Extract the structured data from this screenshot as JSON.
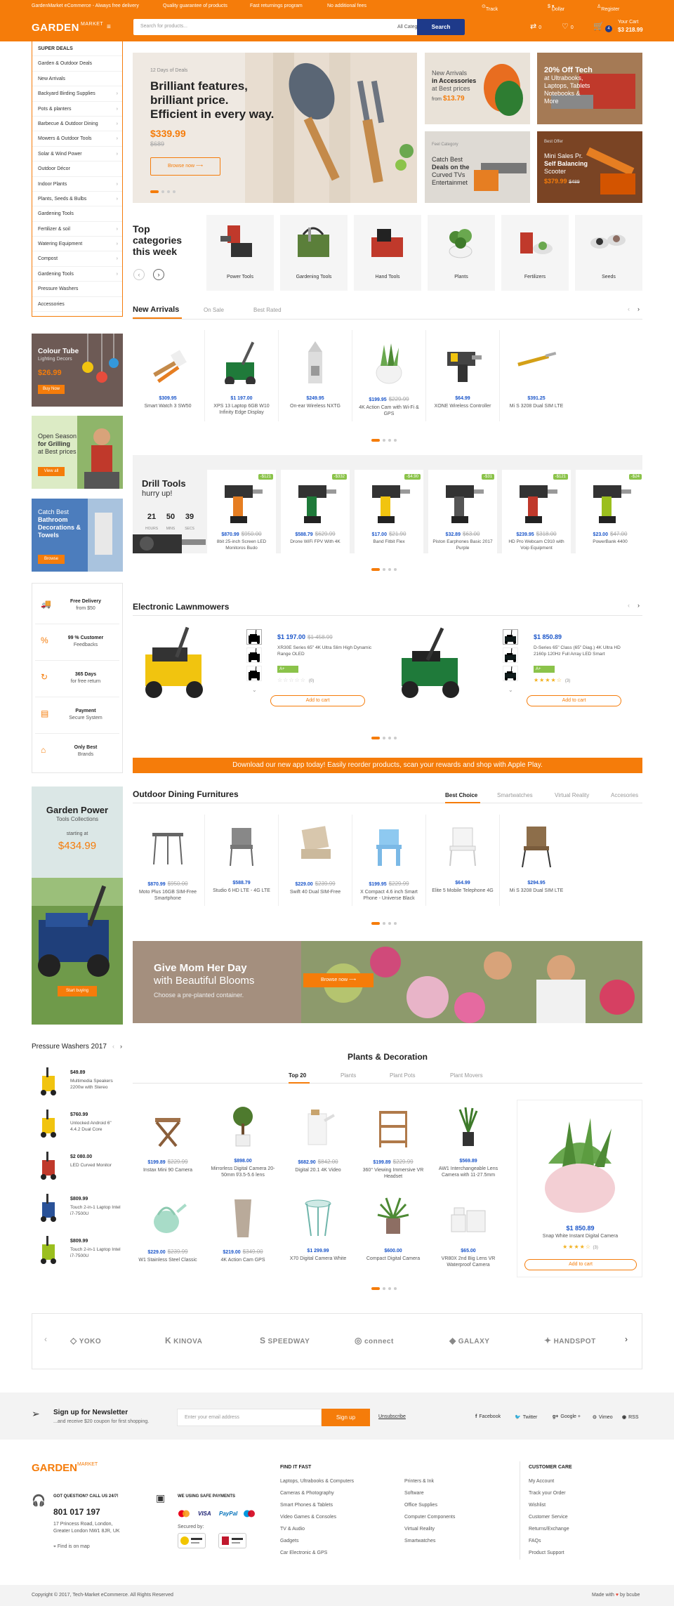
{
  "topbar": {
    "left": "GardenMarket eCommerce - Always free delivery",
    "items": [
      "Quality guarantee of products",
      "Fast returnings program",
      "No additional fees"
    ],
    "track": "Track Your Order",
    "currency": "Dollar (US)",
    "account": "Register or Sign in"
  },
  "header": {
    "logo": "GARDEN",
    "logo_sub": "MARKET",
    "search_placeholder": "Search for products...",
    "category": "All Categories",
    "search_btn": "Search",
    "compare_count": "0",
    "wishlist_count": "0",
    "cart_count": "4",
    "cart_label": "Your Cart",
    "cart_total": "$3 218.99"
  },
  "sidebar": {
    "items": [
      {
        "label": "SUPER DEALS",
        "arrow": false
      },
      {
        "label": "Garden & Outdoor Deals",
        "arrow": false
      },
      {
        "label": "New Arrivals",
        "arrow": false
      },
      {
        "label": "Backyard Birding Supplies",
        "arrow": true
      },
      {
        "label": "Pots & planters",
        "arrow": true
      },
      {
        "label": "Barbecue & Outdoor Dining",
        "arrow": true
      },
      {
        "label": "Mowers & Outdoor Tools",
        "arrow": true
      },
      {
        "label": "Solar & Wind Power",
        "arrow": true
      },
      {
        "label": "Outdoor Décor",
        "arrow": false
      },
      {
        "label": "Indoor Plants",
        "arrow": true
      },
      {
        "label": "Plants, Seeds & Bulbs",
        "arrow": true
      },
      {
        "label": "Gardening Tools",
        "arrow": false
      },
      {
        "label": "Fertilizer & soil",
        "arrow": true
      },
      {
        "label": "Watering Equipment",
        "arrow": true
      },
      {
        "label": "Compost",
        "arrow": true
      },
      {
        "label": "Gardening Tools",
        "arrow": true
      },
      {
        "label": "Pressure Washers",
        "arrow": false
      },
      {
        "label": "Accessories",
        "arrow": false
      }
    ]
  },
  "hero": {
    "kicker": "12 Days of Deals",
    "line1": "Brilliant features,",
    "line2": "brilliant price.",
    "line3": "Efficient in every way.",
    "price": "$339.99",
    "old_price": "$689",
    "btn": "Browse now"
  },
  "promos": {
    "p1": {
      "l1": "New Arrivals",
      "l2": "in Accessories",
      "l3": "at Best prices",
      "from": "from",
      "price": "$13.79"
    },
    "p2": {
      "l1": "20% Off Tech",
      "l2": "at Ultrabooks,",
      "l3": "Laptops, Tablets",
      "l4": "Notebooks &",
      "l5": "More"
    },
    "p3": {
      "kicker": "Feel Category",
      "l1": "Catch Best",
      "l2": "Deals on the",
      "l3": "Curved TVs",
      "l4": "Entertainmet"
    },
    "p4": {
      "kicker": "Best Offer",
      "l1": "Mini Sales Pr.",
      "l2": "Self Balancing",
      "l3": "Scooter",
      "price": "$379.99",
      "old": "$489"
    }
  },
  "top_categories": {
    "title1": "Top",
    "title2": "categories",
    "title3": "this week",
    "items": [
      "Power Tools",
      "Gardening Tools",
      "Hand Tools",
      "Plants",
      "Fertilizers",
      "Seeds"
    ]
  },
  "arrivals": {
    "tabs": [
      "New Arrivals",
      "On Sale",
      "Best Rated"
    ],
    "products": [
      {
        "price": "$309.95",
        "old": "",
        "name": "Smart Watch 3 SW50"
      },
      {
        "price": "$1 197.00",
        "old": "",
        "name": "XPS 13 Laptop 6GB W10 Infinity Edge Display"
      },
      {
        "price": "$249.95",
        "old": "",
        "name": "On-ear Wireless NXTG"
      },
      {
        "price": "$199.95",
        "old": "$229.99",
        "name": "4K Action Cam with Wi-Fi & GPS"
      },
      {
        "price": "$64.99",
        "old": "",
        "name": "XONE Wireless Controller"
      },
      {
        "price": "$391.25",
        "old": "",
        "name": "Mi S 3208 Dual SIM LTE"
      }
    ]
  },
  "drill": {
    "title": "Drill Tools",
    "subtitle": "hurry up!",
    "counter": [
      {
        "v": "21",
        "l": "HOURS"
      },
      {
        "v": "50",
        "l": "MINS"
      },
      {
        "v": "39",
        "l": "SECS"
      }
    ],
    "products": [
      {
        "badge": "-$121",
        "price": "$870.99",
        "old": "$950.00",
        "name": "8bit 25-inch Screen LED Monitoros Budo"
      },
      {
        "badge": "-$332",
        "price": "$588.79",
        "old": "$629.99",
        "name": "Drone WiFi FPV With 4K"
      },
      {
        "badge": "-$4.90",
        "price": "$17.00",
        "old": "$21.90",
        "name": "Band Fitbit Flex"
      },
      {
        "badge": "-$31",
        "price": "$32.89",
        "old": "$63.00",
        "name": "Piston Earphones Basic 2017 Purple"
      },
      {
        "badge": "-$121",
        "price": "$239.95",
        "old": "$318.00",
        "name": "HD Pro Webcam C910 with Voip Equipment"
      },
      {
        "badge": "-$24",
        "price": "$23.00",
        "old": "$47.00",
        "name": "PowerBank 4400"
      }
    ]
  },
  "features": [
    {
      "icon": "truck-icon",
      "l1": "Free Delivery",
      "l2": "from $50"
    },
    {
      "icon": "percent-icon",
      "l1": "99 % Customer",
      "l2": "Feedbacks"
    },
    {
      "icon": "refresh-icon",
      "l1": "365 Days",
      "l2": "for free return"
    },
    {
      "icon": "payment-icon",
      "l1": "Payment",
      "l2": "Secure System"
    },
    {
      "icon": "tag-icon",
      "l1": "Only Best",
      "l2": "Brands"
    }
  ],
  "side_banners": {
    "b1": {
      "l1": "Colour Tube",
      "l2": "Lighting Decors",
      "price": "$26.99",
      "btn": "Buy Now"
    },
    "b2": {
      "l1": "Open Season",
      "l2": "for Grilling",
      "l3": "at Best prices",
      "btn": "View all"
    },
    "b3": {
      "l1": "Catch Best",
      "l2": "Bathroom",
      "l3": "Decorations &",
      "l4": "Towels",
      "btn": "Browse"
    }
  },
  "lawnmowers": {
    "title": "Electronic Lawnmowers",
    "items": [
      {
        "price": "$1 197.00",
        "old": "$1 458.99",
        "name": "XR30E Series 65\" 4K Ultra Slim High Dynamic Range OLED",
        "badge": "A+",
        "reviews": "(0)",
        "btn": "Add to cart",
        "rating": 0
      },
      {
        "price": "$1 850.89",
        "old": "",
        "name": "D-Series 65\" Class (65\" Diag.) 4K Ultra HD 2160p 120Hz Full Array LED Smart",
        "badge": "A+",
        "reviews": "(3)",
        "btn": "Add to cart",
        "rating": 4
      }
    ]
  },
  "app_banner": "Download our new app today! Easily reorder products, scan your rewards and shop with Apple Play.",
  "garden_power": {
    "title": "Garden Power",
    "sub": "Tools Collections",
    "starting": "starting at",
    "price": "$434.99",
    "btn": "Start buying"
  },
  "dining": {
    "title": "Outdoor Dining Furnitures",
    "tabs": [
      "Best Choice",
      "Smartwatches",
      "Virtual Reality",
      "Accesories"
    ],
    "products": [
      {
        "price": "$870.99",
        "old": "$950.00",
        "name": "Moto Plus 16GB SIM-Free Smartphone"
      },
      {
        "price": "$588.79",
        "old": "",
        "name": "Studio 6 HD LTE - 4G LTE"
      },
      {
        "price": "$229.00",
        "old": "$239.99",
        "name": "Swift 40 Dual SIM-Free"
      },
      {
        "price": "$199.95",
        "old": "$229.99",
        "name": "X Compact 4.6 inch Smart Phone - Universe Black"
      },
      {
        "price": "$64.99",
        "old": "",
        "name": "Elite 5 Mobile Telephone 4G"
      },
      {
        "price": "$294.95",
        "old": "",
        "name": "Mi S 3208 Dual SIM LTE"
      }
    ]
  },
  "mom_banner": {
    "l1": "Give Mom Her Day",
    "l2": "with Beautiful Blooms",
    "l3": "Choose a pre-planted container.",
    "btn": "Browse now"
  },
  "pressure": {
    "title": "Pressure Washers 2017",
    "items": [
      {
        "price": "$49.89",
        "name": "Multimedia Speakers 2200w with Stereo"
      },
      {
        "price": "$760.99",
        "name": "Unlocked Android 6\" 4.4.2 Dual Core"
      },
      {
        "price": "$2 080.00",
        "name": "LED Curved Monitor"
      },
      {
        "price": "$809.99",
        "name": "Touch 2-in-1 Laptop Intel i7-7500U"
      },
      {
        "price": "$809.99",
        "name": "Touch 2-in-1 Laptop Intel i7-7500U"
      }
    ]
  },
  "plants": {
    "title": "Plants & Decoration",
    "tabs": [
      "Top 20",
      "Plants",
      "Plant Pots",
      "Plant Movers"
    ],
    "products": [
      {
        "price": "$199.89",
        "old": "$229.99",
        "name": "Instax Mini 90 Camera"
      },
      {
        "price": "$898.00",
        "old": "",
        "name": "Mirrorless Digital Camera 20-50mm f/3.5-5.6 lens"
      },
      {
        "price": "$682.90",
        "old": "$842.00",
        "name": "Digital 20.1 4K Video"
      },
      {
        "price": "$199.89",
        "old": "$229.99",
        "name": "360° Viewing Immersive VR Headset"
      },
      {
        "price": "$569.89",
        "old": "",
        "name": "AW1 Interchangeable Lens Camera with 11-27.5mm"
      },
      {
        "price": "$229.00",
        "old": "$239.99",
        "name": "W1 Stainless Steel Classic"
      },
      {
        "price": "$219.00",
        "old": "$349.00",
        "name": "4K Action Cam GPS"
      },
      {
        "price": "$1 299.99",
        "old": "",
        "name": "X70 Digital Camera White"
      },
      {
        "price": "$600.00",
        "old": "",
        "name": "Compact Digital Camera"
      },
      {
        "price": "$65.00",
        "old": "",
        "name": "VR80X 2nd Big Lens VR Waterproof Camera"
      }
    ],
    "featured": {
      "price": "$1 850.89",
      "name": "Snap White Instant Digital Camera",
      "reviews": "(3)",
      "btn": "Add to cart",
      "rating": 4
    }
  },
  "brands": [
    "YOKO",
    "KINOVA",
    "SPEEDWAY",
    "connect",
    "GALAXY",
    "HANDSPOT"
  ],
  "newsletter": {
    "title": "Sign up for Newsletter",
    "sub": "...and receive $20 coupon for first shopping.",
    "placeholder": "Enter your email address",
    "btn": "Sign up",
    "unsub": "Unsubscribe",
    "social": [
      "Facebook",
      "Twitter",
      "Google +",
      "Vimeo",
      "RSS"
    ]
  },
  "footer": {
    "question": "GOT QUESTION? CALL US 24/7!",
    "phone": "801 017 197",
    "address1": "17 Princess Road, London,",
    "address2": "Greater London NW1 8JR, UK",
    "map": "Find is on map",
    "payments_title": "WE USING SAFE PAYMENTS",
    "payments": [
      "VISA",
      "PayPal"
    ],
    "secured": "Secured by:",
    "find_title": "FIND IT FAST",
    "find1": [
      "Laptops, Ultrabooks & Computers",
      "Cameras & Photography",
      "Smart Phones & Tablets",
      "Video Games & Consoles",
      "TV & Audio",
      "Gadgets",
      "Car Electronic & GPS"
    ],
    "find2": [
      "Printers & Ink",
      "Software",
      "Office Supplies",
      "Computer Components",
      "Virtual Reality",
      "Smartwatches"
    ],
    "care_title": "CUSTOMER CARE",
    "care": [
      "My Account",
      "Track your Order",
      "Wishlist",
      "Customer Service",
      "Returns/Exchange",
      "FAQs",
      "Product Support"
    ],
    "copyright": "Copyright © 2017, Tech-Market eCommerce. All Rights Reserved",
    "made": "Made with",
    "by": "by bcube"
  }
}
